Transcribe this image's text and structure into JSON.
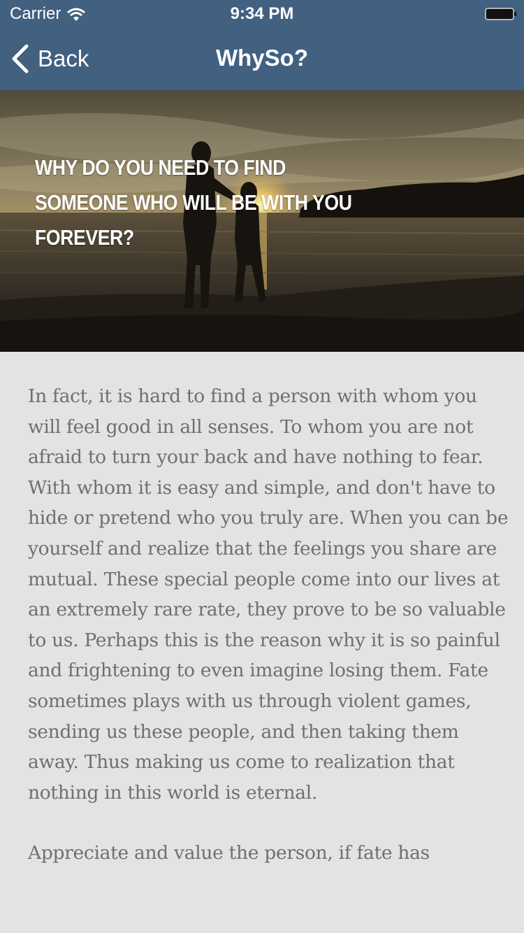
{
  "status_bar": {
    "carrier": "Carrier",
    "time": "9:34 PM",
    "icons": [
      "wifi-icon",
      "battery-icon"
    ]
  },
  "nav": {
    "back_label": "Back",
    "back_icon": "chevron-left-icon",
    "title": "WhySo?"
  },
  "hero": {
    "headline": "Why do you need to find someone who will be with you forever?",
    "image": "silhouette-couple-beach-sunset"
  },
  "article": {
    "paragraphs": [
      "In fact, it is hard to find a person with whom you will feel good in all senses. To whom you are not afraid to turn your back and have nothing to fear. With whom it is easy and simple, and don't have to hide or pretend who you truly are. When you can be yourself and realize that the feelings you share are mutual. These special people come into our lives at an extremely rare rate, they prove to be so valuable to us. Perhaps this is the reason why it is so painful and frightening to even imagine losing them. Fate sometimes plays with us through violent games, sending us these people, and then taking them away. Thus making us come to realization that nothing in this world is eternal.",
      "Appreciate and value the person, if fate has"
    ]
  },
  "colors": {
    "nav_background": "#426080",
    "page_background": "#e3e3e3",
    "body_text": "#6f6f6f"
  }
}
